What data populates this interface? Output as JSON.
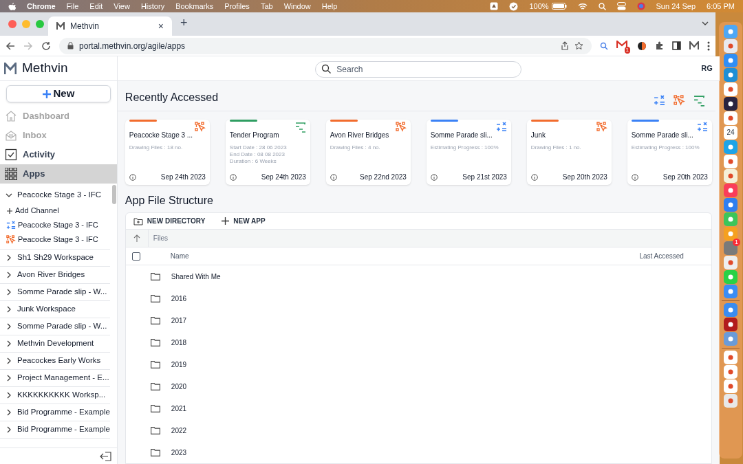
{
  "menu_bar": {
    "app": "Chrome",
    "items": [
      "File",
      "Edit",
      "View",
      "History",
      "Bookmarks",
      "Profiles",
      "Tab",
      "Window",
      "Help"
    ],
    "battery": "100%",
    "date": "Sun 24 Sep",
    "time": "6:05 PM"
  },
  "browser": {
    "tab": {
      "title": "Methvin",
      "close": "×"
    },
    "new_tab": "+",
    "url": "portal.methvin.org/agile/apps",
    "mail_badge": "1"
  },
  "sidebar": {
    "logo": "Methvin",
    "new_button": "New",
    "nav": [
      {
        "label": "Dashboard",
        "kind": "home",
        "disabled": true,
        "selected": false
      },
      {
        "label": "Inbox",
        "kind": "inbox",
        "disabled": true,
        "selected": false
      },
      {
        "label": "Activity",
        "kind": "check",
        "disabled": false,
        "selected": false
      },
      {
        "label": "Apps",
        "kind": "grid",
        "disabled": false,
        "selected": true
      }
    ],
    "workspaces": [
      {
        "label": "Peacocke Stage 3 - IFC",
        "expanded": true,
        "children": [
          {
            "kind": "add",
            "label": "Add Channel"
          },
          {
            "kind": "estimating",
            "label": "Peacocke Stage 3 - IFC"
          },
          {
            "kind": "drawing",
            "label": "Peacocke Stage 3 - IFC"
          }
        ]
      },
      {
        "label": "Sh1 Sh29 Workspace",
        "expanded": false
      },
      {
        "label": "Avon River Bridges",
        "expanded": false
      },
      {
        "label": "Somme Parade slip - W...",
        "expanded": false
      },
      {
        "label": "Junk Workspace",
        "expanded": false
      },
      {
        "label": "Somme Parade slip - W...",
        "expanded": false
      },
      {
        "label": "Methvin Development",
        "expanded": false
      },
      {
        "label": "Peacockes Early Works",
        "expanded": false
      },
      {
        "label": "Project Management - E...",
        "expanded": false
      },
      {
        "label": "KKKKKKKKKK Worksp...",
        "expanded": false
      },
      {
        "label": "Bid Programme - Example",
        "expanded": false
      },
      {
        "label": "Bid Programme - Example",
        "expanded": false
      }
    ]
  },
  "header": {
    "search_placeholder": "Search",
    "avatar": "RG"
  },
  "recent": {
    "title": "Recently Accessed",
    "filters": [
      {
        "kind": "estimating"
      },
      {
        "kind": "drawing"
      },
      {
        "kind": "program"
      }
    ],
    "cards": [
      {
        "kind": "drawing",
        "title": "Peacocke Stage 3 ...",
        "details": [
          "Drawing Files : 18 no."
        ],
        "date": "Sep 24th 2023"
      },
      {
        "kind": "program",
        "title": "Tender Program",
        "details": [
          "Start Date : 28 06 2023",
          "End Date : 08 08 2023",
          "Duration : 6 Weeks"
        ],
        "date": "Sep 24th 2023"
      },
      {
        "kind": "drawing",
        "title": "Avon River Bridges",
        "details": [
          "Drawing Files : 4 no."
        ],
        "date": "Sep 22nd 2023"
      },
      {
        "kind": "estimating",
        "title": "Somme Parade sli...",
        "details": [
          "Estimating Progress : 100%"
        ],
        "date": "Sep 21st 2023"
      },
      {
        "kind": "drawing",
        "title": "Junk",
        "details": [
          "Drawing Files : 1 no."
        ],
        "date": "Sep 20th 2023"
      },
      {
        "kind": "estimating",
        "title": "Somme Parade sli...",
        "details": [
          "Estimating Progress : 100%"
        ],
        "date": "Sep 20th 2023"
      }
    ]
  },
  "files": {
    "title": "App File Structure",
    "actions": [
      "NEW DIRECTORY",
      "NEW APP"
    ],
    "breadcrumb": "Files",
    "select_all_checked": false,
    "columns": [
      "Name",
      "Last Accessed"
    ],
    "rows": [
      {
        "name": "Shared With Me"
      },
      {
        "name": "2016"
      },
      {
        "name": "2017"
      },
      {
        "name": "2018"
      },
      {
        "name": "2019"
      },
      {
        "name": "2020"
      },
      {
        "name": "2021"
      },
      {
        "name": "2022"
      },
      {
        "name": "2023"
      }
    ]
  },
  "dock": {
    "calendar_day": "24",
    "badge": "1"
  }
}
